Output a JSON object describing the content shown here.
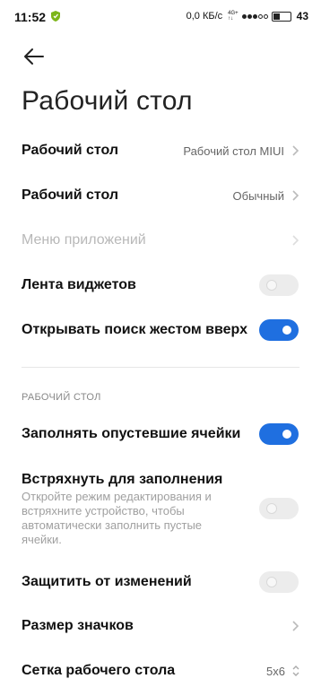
{
  "status": {
    "time": "11:52",
    "speed": "0,0 КБ/с",
    "net_top": "4G+",
    "net_bottom": "↑↓",
    "battery": "43"
  },
  "header": {
    "title": "Рабочий стол"
  },
  "rows": {
    "desktop_type": {
      "label": "Рабочий стол",
      "value": "Рабочий стол MIUI"
    },
    "desktop_mode": {
      "label": "Рабочий стол",
      "value": "Обычный"
    },
    "app_menu": {
      "label": "Меню приложений"
    },
    "widgets_feed": {
      "label": "Лента виджетов",
      "toggle": false
    },
    "swipe_search": {
      "label": "Открывать поиск жестом вверх",
      "toggle": true
    }
  },
  "section": {
    "header": "РАБОЧИЙ СТОЛ",
    "fill_cells": {
      "label": "Заполнять опустевшие ячейки",
      "toggle": true
    },
    "shake_fill": {
      "label": "Встряхнуть для заполнения",
      "description": "Откройте режим редактирования и встряхните устройство, чтобы автоматически заполнить пустые ячейки.",
      "toggle": false
    },
    "lock_layout": {
      "label": "Защитить от изменений",
      "toggle": false
    },
    "icon_size": {
      "label": "Размер значков"
    },
    "grid": {
      "label": "Сетка рабочего стола",
      "value": "5x6"
    }
  },
  "colors": {
    "accent": "#1f6fe0",
    "toggle_off": "#ececec",
    "shield": "#7cb518"
  },
  "icons": [
    "back-arrow-icon",
    "chevron-right-icon",
    "stepper-icon",
    "shield-icon"
  ]
}
